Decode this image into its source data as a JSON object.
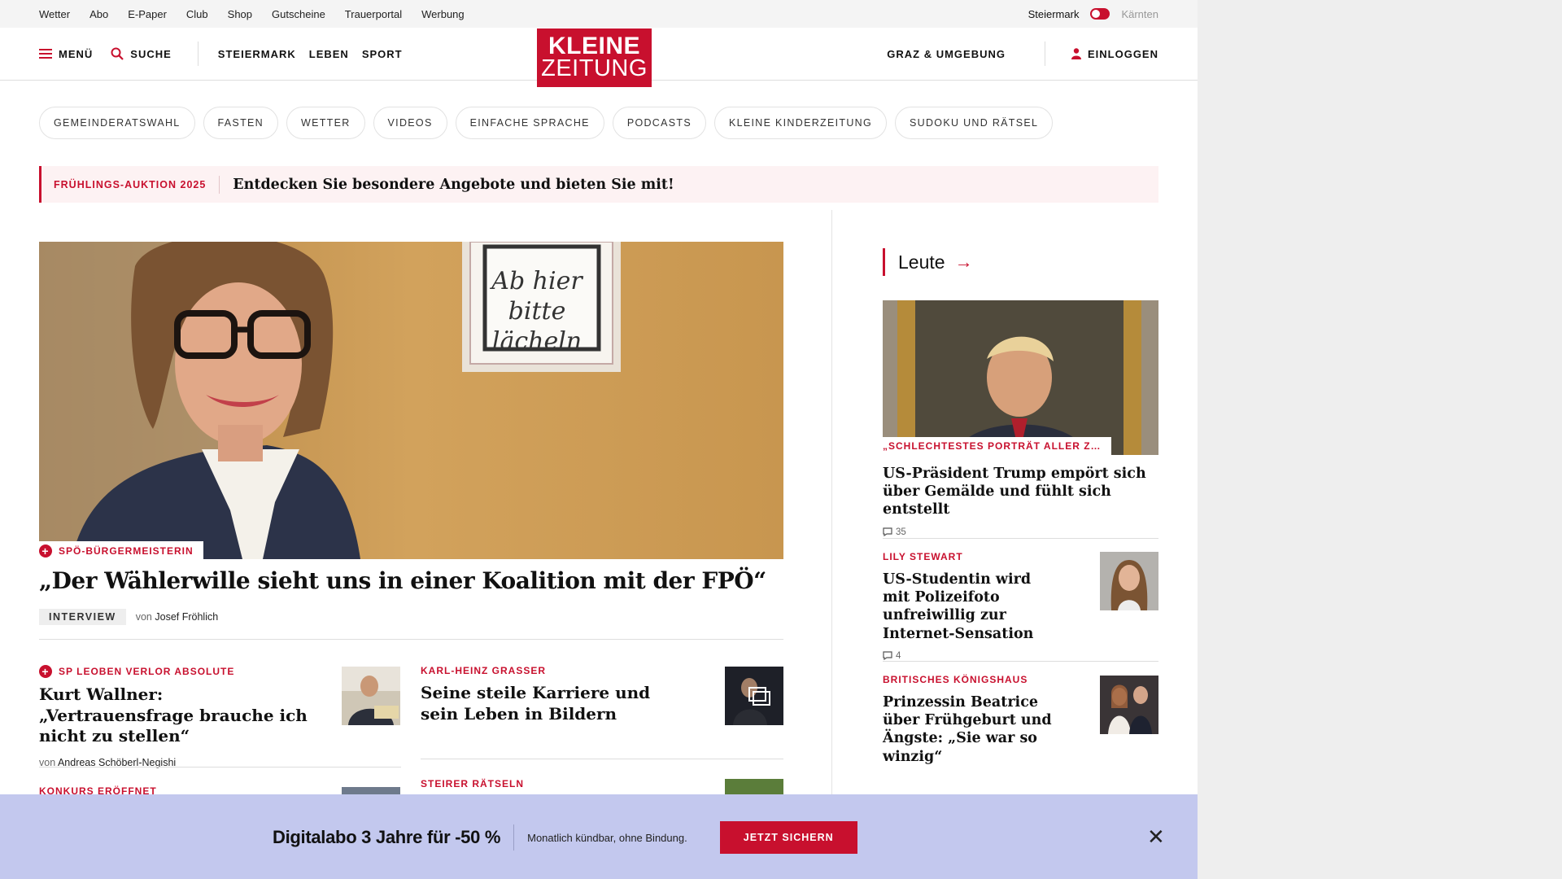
{
  "utility": {
    "links": [
      "Wetter",
      "Abo",
      "E-Paper",
      "Club",
      "Shop",
      "Gutscheine",
      "Trauerportal",
      "Werbung"
    ],
    "region_active": "Steiermark",
    "region_inactive": "Kärnten"
  },
  "nav": {
    "menu": "MENÜ",
    "search": "SUCHE",
    "links": [
      "STEIERMARK",
      "LEBEN",
      "SPORT"
    ],
    "logo_line1": "KLEINE",
    "logo_line2": "ZEITUNG",
    "local": "GRAZ & UMGEBUNG",
    "login": "EINLOGGEN"
  },
  "pills": [
    "GEMEINDERATSWAHL",
    "FASTEN",
    "WETTER",
    "VIDEOS",
    "EINFACHE SPRACHE",
    "PODCASTS",
    "KLEINE KINDERZEITUNG",
    "SUDOKU UND RÄTSEL"
  ],
  "promo": {
    "tag": "FRÜHLINGS-AUKTION 2025",
    "text": "Entdecken Sie besondere Angebote und bieten Sie mit!"
  },
  "hero": {
    "kicker": "SPÖ-BÜRGERMEISTERIN",
    "title": "„Der Wählerwille sieht uns in einer Koalition mit der FPÖ“",
    "badge": "INTERVIEW",
    "by": "von",
    "author": "Josef Fröhlich",
    "sign_text": [
      "Ab hier",
      "bitte",
      "lächeln"
    ]
  },
  "teasers": [
    {
      "kicker": "SP LEOBEN VERLOR ABSOLUTE",
      "title": "Kurt Wallner: „Vertrauensfrage brauche ich nicht zu stellen“",
      "by": "von",
      "author": "Andreas Schöberl-Negishi"
    },
    {
      "kicker": "KARL-HEINZ GRASSER",
      "title": "Seine steile Karriere und sein Leben in Bildern"
    },
    {
      "kicker": "KONKURS ERÖFFNET"
    },
    {
      "kicker": "STEIRER RÄTSELN"
    }
  ],
  "sidebar": {
    "heading": "Leute",
    "lead": {
      "kicker": "„SCHLECHTESTES PORTRÄT ALLER Z…",
      "title": "US-Präsident Trump empört sich über Gemälde und fühlt sich entstellt",
      "comments": "35"
    },
    "items": [
      {
        "kicker": "LILY STEWART",
        "title": "US-Studentin wird mit Polizeifoto unfreiwillig zur Internet-Sensation",
        "comments": "4"
      },
      {
        "kicker": "BRITISCHES KÖNIGSHAUS",
        "title": "Prinzessin Beatrice über Frühgeburt und Ängste: „Sie war so winzig“"
      }
    ]
  },
  "offer": {
    "headline": "Digitalabo 3 Jahre für -50 %",
    "sub": "Monatlich kündbar, ohne Bindung.",
    "cta": "JETZT SICHERN"
  },
  "colors": {
    "brand_red": "#c8102e",
    "offer_bg": "#c3c8ee",
    "promo_bg": "#fdf2f3"
  }
}
